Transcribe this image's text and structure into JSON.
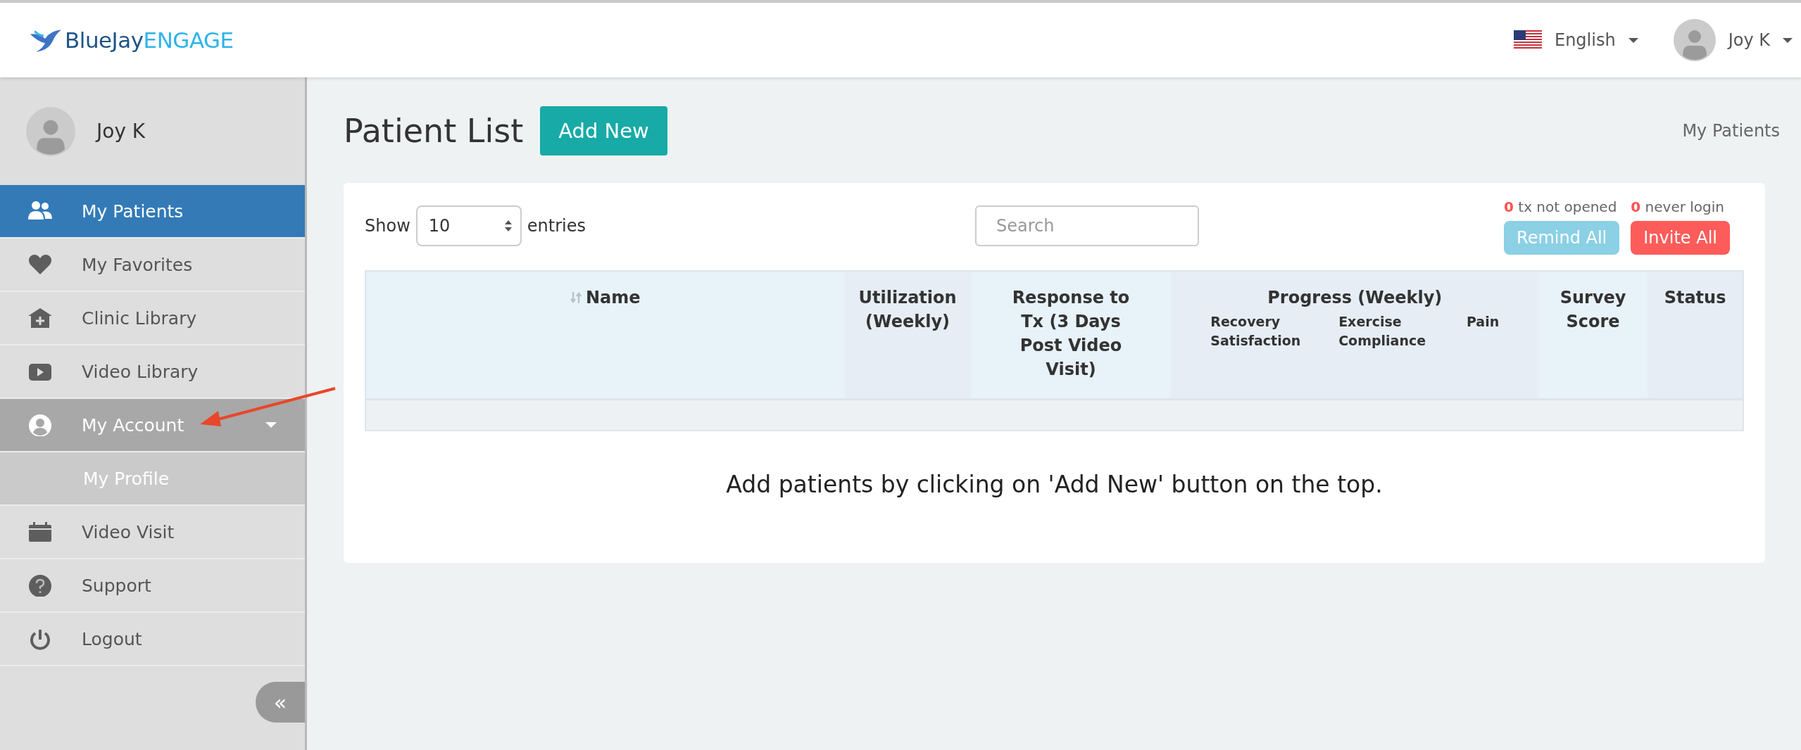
{
  "header": {
    "logo": {
      "part1": "BlueJay",
      "part2": "ENGAGE"
    },
    "language": "English",
    "user": "Joy K"
  },
  "sidebar": {
    "user": "Joy K",
    "items": [
      {
        "label": "My Patients",
        "selected": true
      },
      {
        "label": "My Favorites",
        "selected": false
      },
      {
        "label": "Clinic Library",
        "selected": false
      },
      {
        "label": "Video Library",
        "selected": false
      },
      {
        "label": "My Account",
        "selected": false,
        "expanded": true,
        "children": [
          {
            "label": "My Profile",
            "selected": false
          }
        ]
      },
      {
        "label": "Video Visit",
        "selected": false
      },
      {
        "label": "Support",
        "selected": false
      },
      {
        "label": "Logout",
        "selected": false
      }
    ],
    "collapse_button": "«"
  },
  "page": {
    "title": "Patient List",
    "add_button": "Add New",
    "breadcrumb": "My Patients"
  },
  "controls": {
    "show_label": "Show",
    "entries_value": "10",
    "entries_label": "entries",
    "search_placeholder": "Search",
    "stats": [
      {
        "count": "0",
        "label": "tx not opened"
      },
      {
        "count": "0",
        "label": "never login"
      }
    ],
    "buttons": [
      {
        "label": "Remind All",
        "kind": "remind"
      },
      {
        "label": "Invite All",
        "kind": "invite"
      }
    ]
  },
  "table": {
    "columns": [
      {
        "label": "Name",
        "sortable": true
      },
      {
        "label": "Utilization (Weekly)",
        "sortable": false
      },
      {
        "label": "Response to Tx (3 Days Post Video Visit)",
        "sortable": false
      },
      {
        "label": "Progress (Weekly)",
        "sortable": false,
        "subcolumns": [
          "Recovery Satisfaction",
          "Exercise Compliance",
          "Pain"
        ]
      },
      {
        "label": "Survey Score",
        "sortable": false
      },
      {
        "label": "Status",
        "sortable": false
      }
    ],
    "empty_message": "Add patients by clicking on 'Add New' button on the top."
  }
}
